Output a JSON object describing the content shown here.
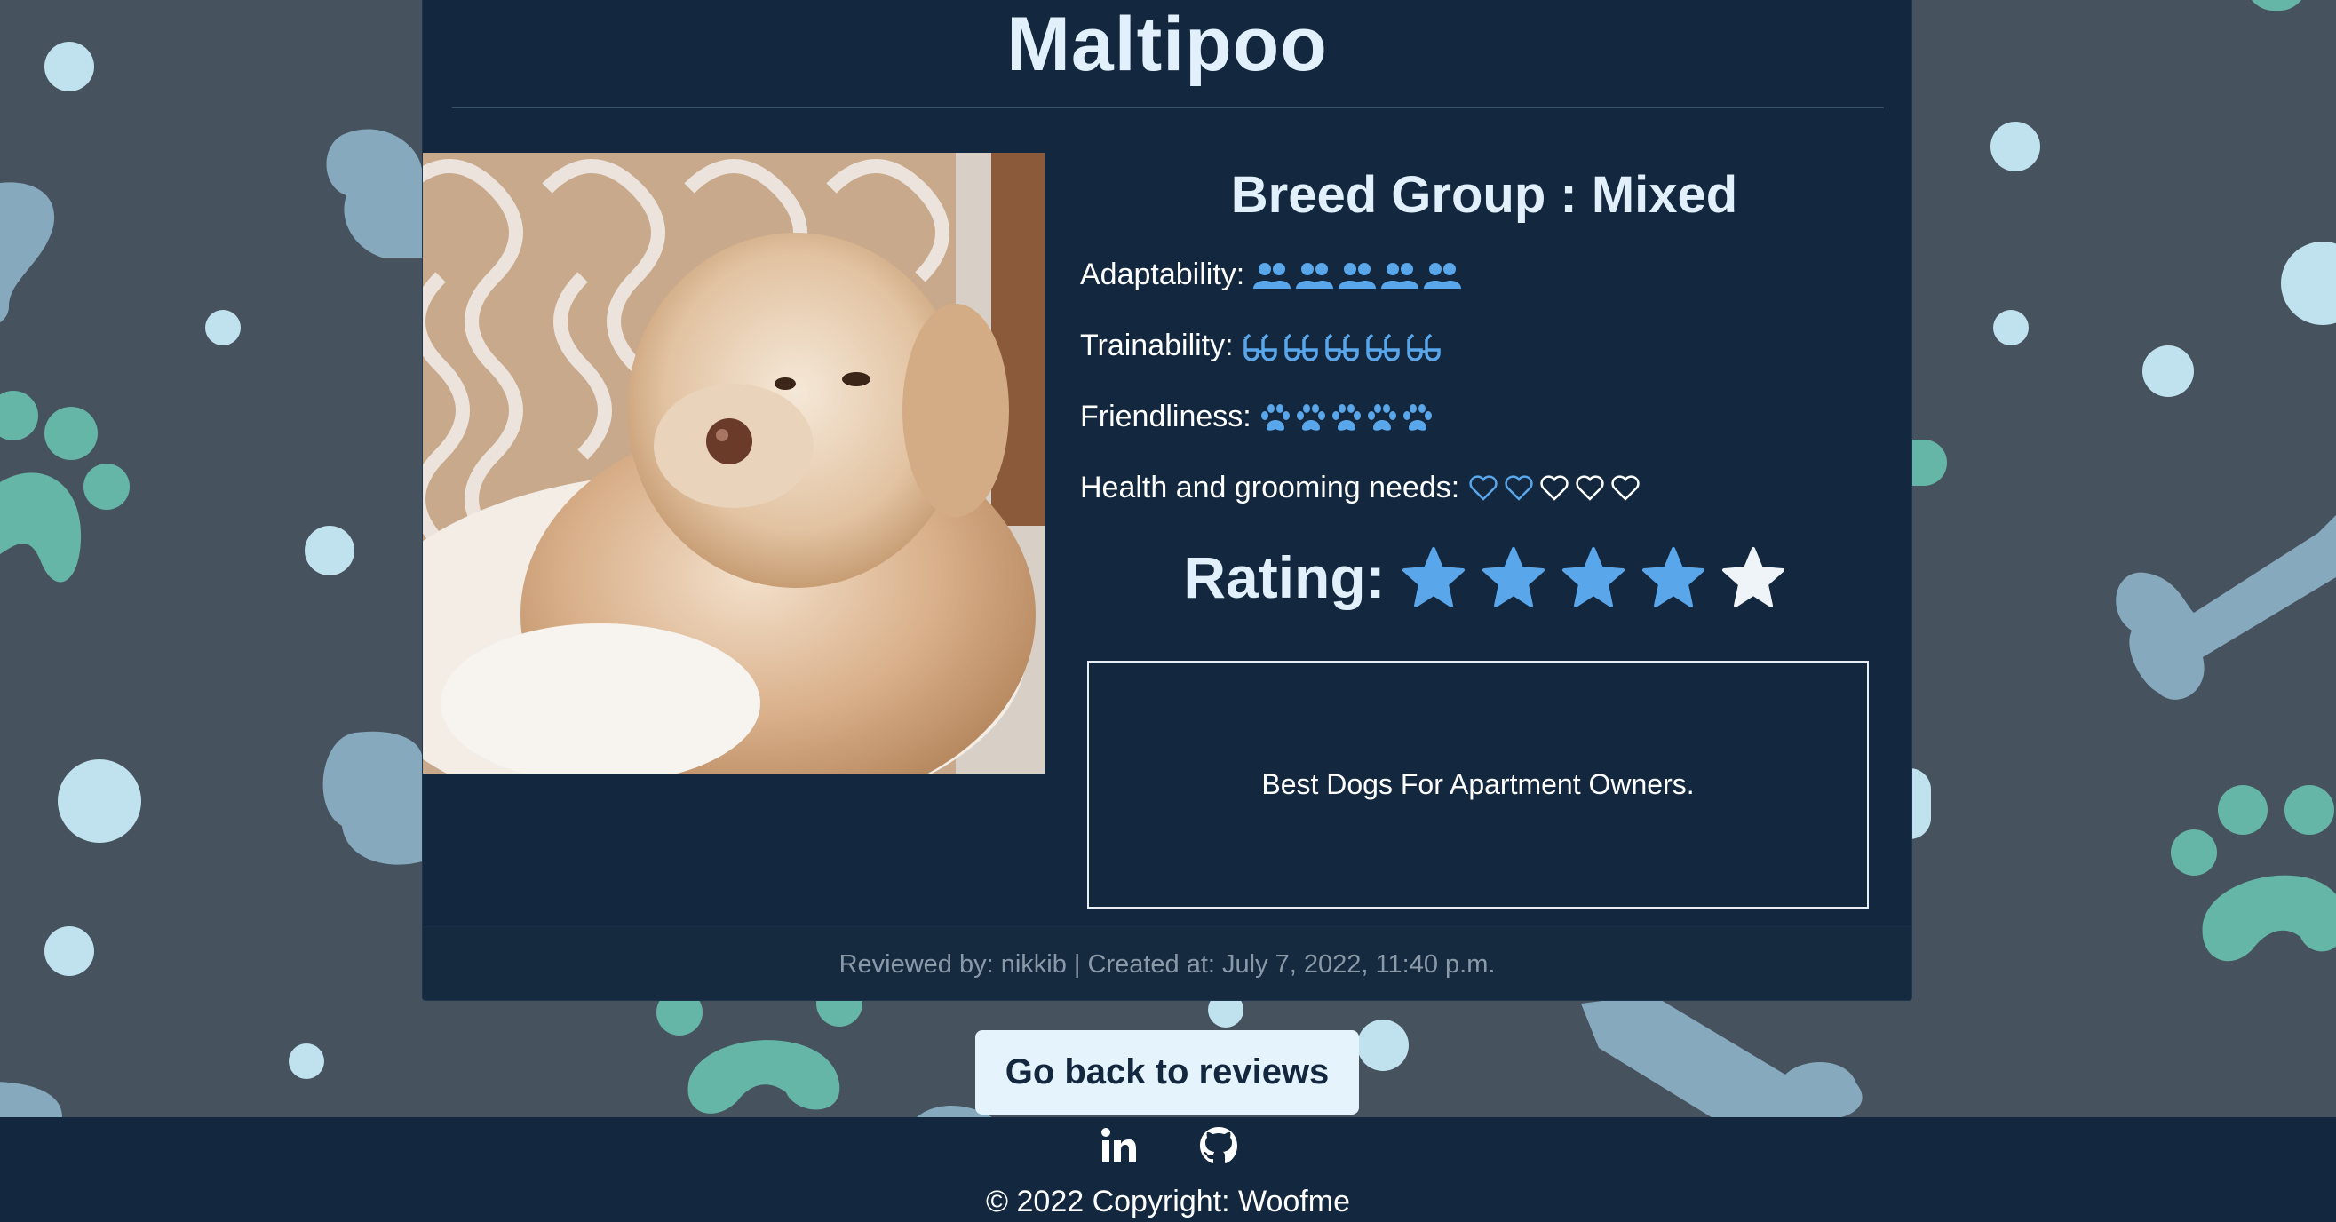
{
  "breed": {
    "name": "Maltipoo"
  },
  "details": {
    "breed_group": "Breed Group : Mixed",
    "traits": [
      {
        "label": "Adaptability:",
        "icon": "users-icon",
        "count": 5,
        "filled": 5
      },
      {
        "label": "Trainability:",
        "icon": "glasses-icon",
        "count": 5,
        "filled": 5
      },
      {
        "label": "Friendliness:",
        "icon": "paw-icon",
        "count": 5,
        "filled": 5
      },
      {
        "label": "Health and grooming needs:",
        "icon": "heart-icon",
        "count": 5,
        "filled": 2
      }
    ],
    "rating_label": "Rating:",
    "rating": {
      "value": 4,
      "max": 5
    },
    "summary": "Best Dogs For Apartment Owners."
  },
  "card_footer": "Reviewed by: nikkib | Created at: July 7, 2022, 11:40 p.m.",
  "back_button": "Go back to reviews",
  "footer": {
    "social": [
      "linkedin-icon",
      "github-icon"
    ],
    "copyright": "© 2022 Copyright: Woofme"
  },
  "colors": {
    "background": "#47525f",
    "card": "#13283f",
    "accent": "#5aa6ea",
    "heading": "#e1f0fa",
    "decor_dot": "#bfe2ee",
    "decor_paw": "#65b6a7",
    "decor_bone": "#86a9bd"
  }
}
